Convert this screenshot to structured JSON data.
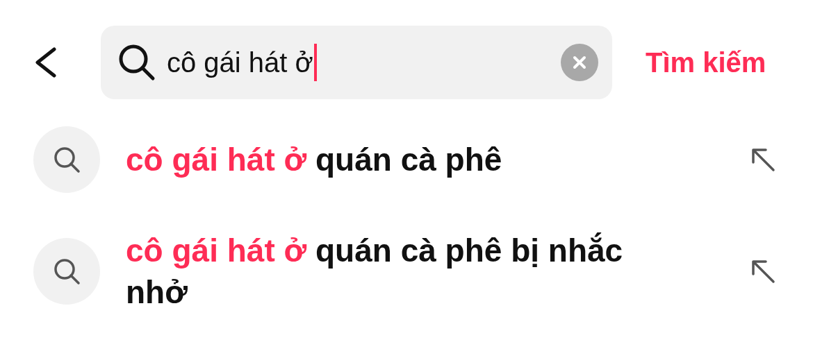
{
  "search": {
    "value": "cô gái hát ở",
    "focused": true
  },
  "search_button": "Tìm kiếm",
  "suggestions": [
    {
      "match": "cô gái hát ở",
      "rest": " quán cà phê"
    },
    {
      "match": "cô gái hát ở",
      "rest": " quán cà phê bị nhắc nhở"
    }
  ]
}
